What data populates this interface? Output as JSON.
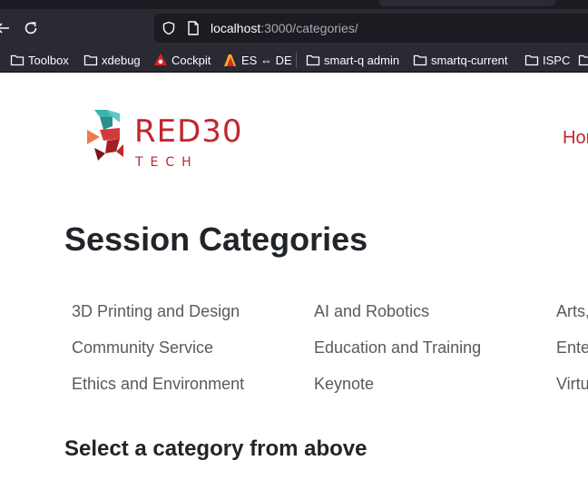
{
  "browser": {
    "url_host": "localhost",
    "url_path": ":3000/categories/"
  },
  "bookmarks": [
    {
      "label": "Toolbox",
      "icon": "folder-icon"
    },
    {
      "label": "xdebug",
      "icon": "folder-icon"
    },
    {
      "label": "Cockpit",
      "icon": "cockpit-icon"
    },
    {
      "label": "ES ⇔ DE",
      "icon": "translate-icon"
    },
    {
      "label": "smart-q admin",
      "icon": "folder-icon"
    },
    {
      "label": "smartq-current",
      "icon": "folder-icon"
    },
    {
      "label": "ISPC",
      "icon": "folder-icon"
    }
  ],
  "site": {
    "logo_word": "RED30",
    "logo_sub": "TECH",
    "nav_home": "Hor",
    "brand_color": "#c1272d",
    "logo_teal": "#3fb3b0"
  },
  "main": {
    "title": "Session Categories",
    "categories": [
      [
        "3D Printing and Design",
        "AI and Robotics",
        "Arts,"
      ],
      [
        "Community Service",
        "Education and Training",
        "Ente"
      ],
      [
        "Ethics and Environment",
        "Keynote",
        "Virtu"
      ]
    ],
    "subheading": "Select a category from above"
  }
}
